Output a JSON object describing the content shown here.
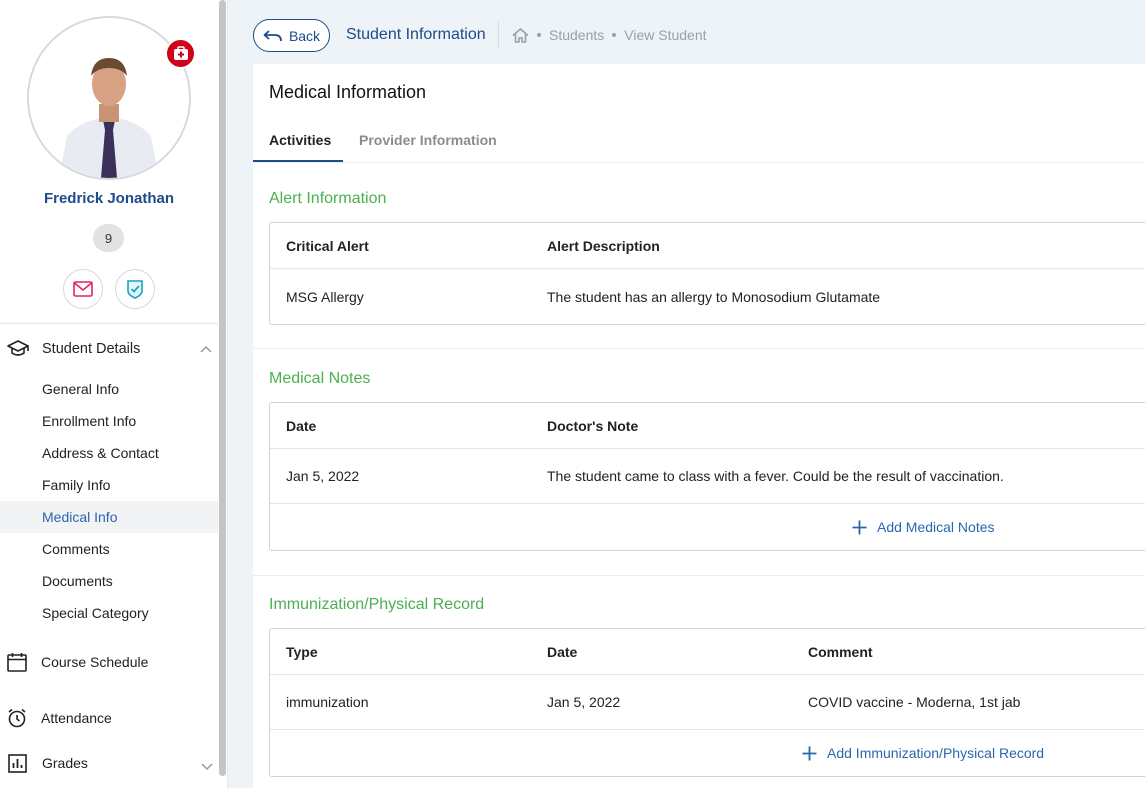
{
  "student": {
    "name": "Fredrick Jonathan",
    "grade": "9"
  },
  "nav": {
    "student_details": "Student Details",
    "sub_items": [
      "General Info",
      "Enrollment Info",
      "Address & Contact",
      "Family Info",
      "Medical Info",
      "Comments",
      "Documents",
      "Special Category"
    ],
    "active_sub": "Medical Info",
    "course_schedule": "Course Schedule",
    "attendance": "Attendance",
    "grades": "Grades"
  },
  "header": {
    "back_label": "Back",
    "title": "Student Information",
    "breadcrumb": [
      "Students",
      "View Student"
    ]
  },
  "card": {
    "title": "Medical Information",
    "tabs": [
      "Activities",
      "Provider Information"
    ]
  },
  "alert": {
    "title": "Alert Information",
    "headers": [
      "Critical Alert",
      "Alert Description"
    ],
    "rows": [
      [
        "MSG Allergy",
        "The student has an allergy to Monosodium Glutamate"
      ]
    ]
  },
  "notes": {
    "title": "Medical Notes",
    "headers": [
      "Date",
      "Doctor's Note"
    ],
    "rows": [
      [
        "Jan 5, 2022",
        "The student came to class with a fever. Could be the result of vaccination."
      ]
    ],
    "add_label": "Add Medical Notes"
  },
  "immunization": {
    "title": "Immunization/Physical Record",
    "headers": [
      "Type",
      "Date",
      "Comment"
    ],
    "rows": [
      [
        "immunization",
        "Jan 5, 2022",
        "COVID vaccine - Moderna, 1st jab"
      ]
    ],
    "add_label": "Add Immunization/Physical Record"
  },
  "colors": {
    "primary": "#1e4b8a",
    "link": "#2a66b0",
    "section_green": "#4caf50",
    "alert_red": "#d0021b"
  }
}
